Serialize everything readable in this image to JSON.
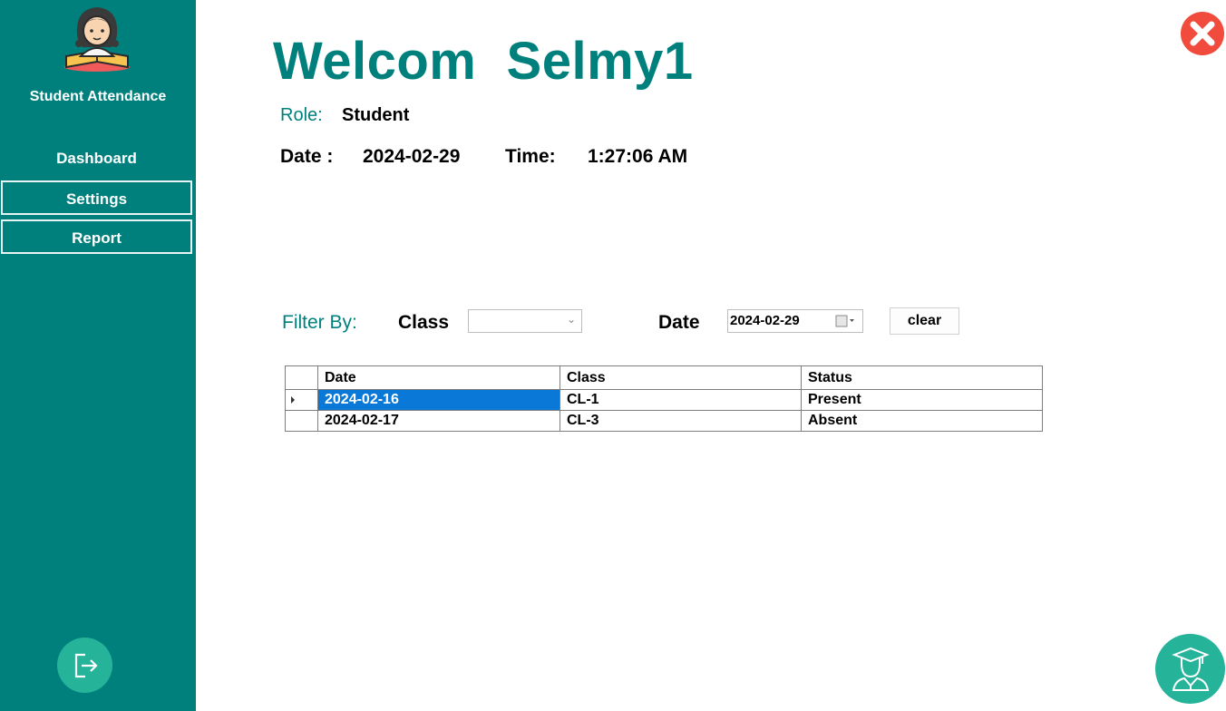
{
  "app": {
    "title": "Student Attendance"
  },
  "sidebar": {
    "items": [
      {
        "label": "Dashboard"
      },
      {
        "label": "Settings"
      },
      {
        "label": "Report"
      }
    ]
  },
  "header": {
    "welcome": "Welcom  Selmy1",
    "role_label": "Role:",
    "role_value": "Student",
    "date_label": "Date :",
    "date_value": "2024-02-29",
    "time_label": "Time:",
    "time_value": "1:27:06 AM"
  },
  "filter": {
    "label": "Filter By:",
    "class_label": "Class",
    "class_value": "",
    "date_label": "Date",
    "date_value": "2024-02-29",
    "clear_label": "clear"
  },
  "table": {
    "columns": [
      "Date",
      "Class",
      "Status"
    ],
    "rows": [
      {
        "date": "2024-02-16",
        "class": "CL-1",
        "status": "Present"
      },
      {
        "date": "2024-02-17",
        "class": "CL-3",
        "status": "Absent"
      }
    ]
  },
  "colors": {
    "sidebar": "#00807d",
    "accent_text": "#00807d",
    "round_button": "#25b39a",
    "close": "#f04b3c",
    "selection": "#0a78d7"
  },
  "icons": {
    "logo": "student-reading-icon",
    "logout": "logout-icon",
    "close": "close-icon",
    "profile": "graduate-user-icon",
    "calendar": "calendar-icon"
  }
}
